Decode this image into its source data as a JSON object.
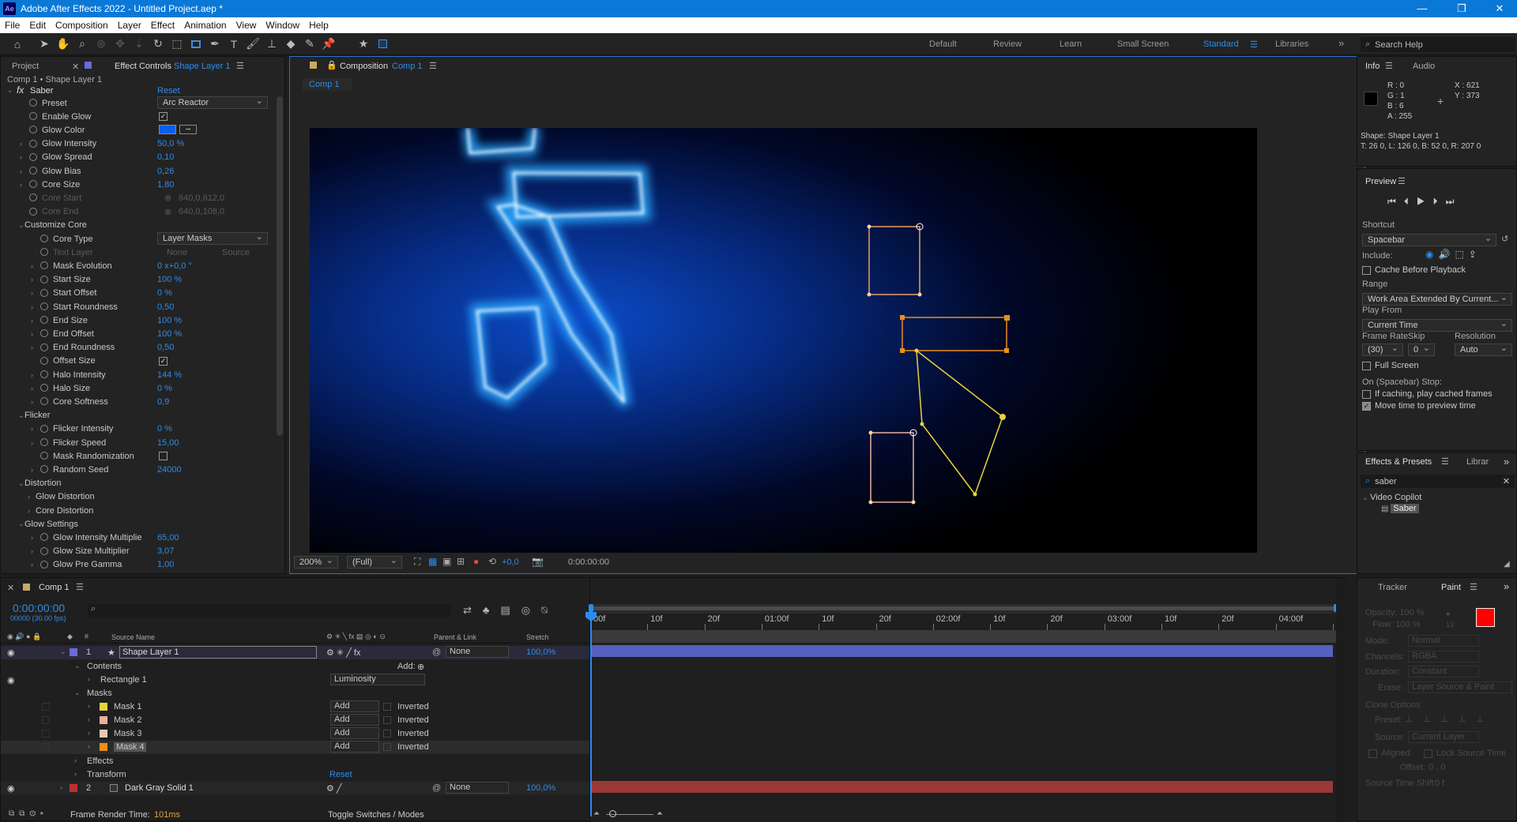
{
  "window": {
    "title": "Adobe After Effects 2022 - Untitled Project.aep *",
    "app_icon": "Ae"
  },
  "menu": [
    "File",
    "Edit",
    "Composition",
    "Layer",
    "Effect",
    "Animation",
    "View",
    "Window",
    "Help"
  ],
  "workspaces": [
    "Default",
    "Review",
    "Learn",
    "Small Screen",
    "Standard",
    "Libraries"
  ],
  "search_help": "Search Help",
  "left_panel": {
    "tab_project": "Project",
    "tab_effect_controls": "Effect Controls",
    "effect_layer": "Shape Layer 1",
    "breadcrumb": "Comp 1 • Shape Layer 1",
    "effect_name": "Saber",
    "reset": "Reset"
  },
  "ec_rows": [
    {
      "label": "Preset",
      "value": "Arc Reactor",
      "type": "dropdown",
      "indent": 0
    },
    {
      "label": "Enable Glow",
      "value": "✓",
      "type": "check",
      "indent": 0
    },
    {
      "label": "Glow Color",
      "value": "",
      "type": "color",
      "indent": 0
    },
    {
      "label": "Glow Intensity",
      "value": "50,0 %",
      "type": "num",
      "indent": 0
    },
    {
      "label": "Glow Spread",
      "value": "0,10",
      "type": "num",
      "indent": 0
    },
    {
      "label": "Glow Bias",
      "value": "0,26",
      "type": "num",
      "indent": 0
    },
    {
      "label": "Core Size",
      "value": "1,80",
      "type": "num",
      "indent": 0
    },
    {
      "label": "Core Start",
      "value": "640,0,612,0",
      "type": "dim",
      "indent": 0
    },
    {
      "label": "Core End",
      "value": "640,0,108,0",
      "type": "dim",
      "indent": 0
    },
    {
      "label": "Customize Core",
      "value": "",
      "type": "group",
      "indent": 0
    },
    {
      "label": "Core Type",
      "value": "Layer Masks",
      "type": "dropdown",
      "indent": 1
    },
    {
      "label": "Text Layer",
      "value": "None",
      "type": "dimdd",
      "indent": 1
    },
    {
      "label": "Mask Evolution",
      "value": "0 x+0,0 °",
      "type": "num",
      "indent": 1
    },
    {
      "label": "Start Size",
      "value": "100 %",
      "type": "num",
      "indent": 1
    },
    {
      "label": "Start Offset",
      "value": "0 %",
      "type": "num",
      "indent": 1
    },
    {
      "label": "Start Roundness",
      "value": "0,50",
      "type": "num",
      "indent": 1
    },
    {
      "label": "End Size",
      "value": "100 %",
      "type": "num",
      "indent": 1
    },
    {
      "label": "End Offset",
      "value": "100 %",
      "type": "num",
      "indent": 1
    },
    {
      "label": "End Roundness",
      "value": "0,50",
      "type": "num",
      "indent": 1
    },
    {
      "label": "Offset Size",
      "value": "✓",
      "type": "check",
      "indent": 1
    },
    {
      "label": "Halo Intensity",
      "value": "144 %",
      "type": "num",
      "indent": 1
    },
    {
      "label": "Halo Size",
      "value": "0 %",
      "type": "num",
      "indent": 1
    },
    {
      "label": "Core Softness",
      "value": "0,9",
      "type": "num",
      "indent": 1
    },
    {
      "label": "Flicker",
      "value": "",
      "type": "group",
      "indent": 0
    },
    {
      "label": "Flicker Intensity",
      "value": "0 %",
      "type": "num",
      "indent": 1
    },
    {
      "label": "Flicker Speed",
      "value": "15,00",
      "type": "num",
      "indent": 1
    },
    {
      "label": "Mask Randomization",
      "value": "",
      "type": "check",
      "indent": 1
    },
    {
      "label": "Random Seed",
      "value": "24000",
      "type": "num",
      "indent": 1
    },
    {
      "label": "Distortion",
      "value": "",
      "type": "group",
      "indent": 0
    },
    {
      "label": "Glow Distortion",
      "value": "",
      "type": "sub",
      "indent": 0
    },
    {
      "label": "Core Distortion",
      "value": "",
      "type": "sub",
      "indent": 0
    },
    {
      "label": "Glow Settings",
      "value": "",
      "type": "group",
      "indent": 0
    },
    {
      "label": "Glow Intensity Multiplie",
      "value": "65,00",
      "type": "num",
      "indent": 1
    },
    {
      "label": "Glow Size Multiplier",
      "value": "3,07",
      "type": "num",
      "indent": 1
    },
    {
      "label": "Glow Pre Gamma",
      "value": "1,00",
      "type": "num",
      "indent": 1
    }
  ],
  "text_layer_source": "Source",
  "comp_panel": {
    "tab": "Composition",
    "comp_name": "Comp 1",
    "sub_tab": "Comp 1",
    "zoom": "200%",
    "resolution": "(Full)",
    "exposure": "+0,0",
    "timecode": "0:00:00:00"
  },
  "info_panel": {
    "tab_info": "Info",
    "tab_audio": "Audio",
    "r": "R : 0",
    "g": "G : 1",
    "b": "B : 6",
    "a": "A : 255",
    "x": "X : 621",
    "y": "Y : 373",
    "shape": "Shape: Shape Layer 1",
    "bounds": "T: 26 0, L: 126 0, B: 52 0, R: 207 0"
  },
  "preview_panel": {
    "title": "Preview",
    "shortcut_label": "Shortcut",
    "shortcut": "Spacebar",
    "include": "Include:",
    "cache": "Cache Before Playback",
    "range_label": "Range",
    "range": "Work Area Extended By Current...",
    "play_from_label": "Play From",
    "play_from": "Current Time",
    "frame_rate_label": "Frame Rate",
    "skip_label": "Skip",
    "resolution_label": "Resolution",
    "frame_rate": "(30)",
    "skip": "0",
    "resolution": "Auto",
    "full_screen": "Full Screen",
    "on_stop": "On (Spacebar) Stop:",
    "if_caching": "If caching, play cached frames",
    "move_time": "Move time to preview time"
  },
  "effects_presets": {
    "tab": "Effects & Presets",
    "tab2": "Librar",
    "search": "saber",
    "category": "Video Copilot",
    "item": "Saber"
  },
  "timeline": {
    "comp": "Comp 1",
    "timecode": "0:00:00:00",
    "fps": "00000 (30.00 fps)",
    "col_source": "Source Name",
    "col_parent": "Parent & Link",
    "col_stretch": "Stretch",
    "layer1": "Shape Layer 1",
    "layer1_num": "1",
    "layer1_parent": "None",
    "layer1_stretch": "100,0%",
    "contents": "Contents",
    "add": "Add:",
    "rectangle": "Rectangle 1",
    "blend": "Luminosity",
    "masks": "Masks",
    "mask_names": [
      "Mask 1",
      "Mask 2",
      "Mask 3",
      "Mask 4"
    ],
    "mask_mode": "Add",
    "inverted": "Inverted",
    "effects": "Effects",
    "transform": "Transform",
    "reset": "Reset",
    "layer2": "Dark Gray Solid 1",
    "layer2_num": "2",
    "layer2_parent": "None",
    "layer2_stretch": "100,0%",
    "render_time_label": "Frame Render Time:",
    "render_time": "101ms",
    "toggle": "Toggle Switches / Modes"
  },
  "ruler": [
    "00f",
    "10f",
    "20f",
    "01:00f",
    "10f",
    "20f",
    "02:00f",
    "10f",
    "20f",
    "03:00f",
    "10f",
    "20f",
    "04:00f",
    "10f"
  ],
  "paint_panel": {
    "tab_tracker": "Tracker",
    "tab_paint": "Paint",
    "opacity": "Opacity: 100 %",
    "flow": "Flow: 100 %",
    "mode": "Mode:",
    "mode_val": "Normal",
    "channels": "Channels:",
    "channels_val": "RGBA",
    "duration": "Duration:",
    "duration_val": "Constant",
    "erase": "Erase:",
    "erase_val": "Layer Source & Paint",
    "clone_options": "Clone Options",
    "preset": "Preset:",
    "source": "Source:",
    "source_val": "Current Layer",
    "aligned": "Aligned",
    "lock_source": "Lock Source Time",
    "offset": "Offset:",
    "offset_val": "0 , 0",
    "source_time_shift": "Source Time Shift:",
    "source_time_shift_val": "0 f",
    "brush": "13",
    "foreground_color": "#ff0000"
  },
  "colors": {
    "accent": "#2d8ceb",
    "mask1": "#e8d23c",
    "mask2": "#e8b0a0",
    "mask3": "#e8c8b0",
    "mask4": "#e8901c",
    "layer1_label": "#6a6ad8",
    "layer2_label": "#c03030"
  }
}
